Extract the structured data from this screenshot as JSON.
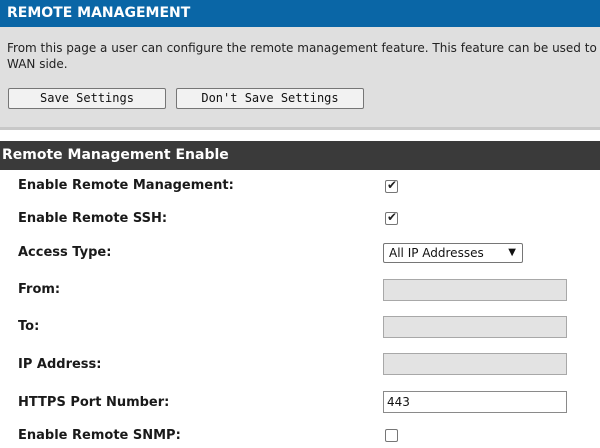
{
  "header": {
    "title": "REMOTE MANAGEMENT"
  },
  "intro": {
    "line1": "From this page a user can configure the remote management feature. This feature can be used to",
    "line2": "WAN side."
  },
  "buttons": {
    "save_label": "Save Settings",
    "dont_save_label": "Don't Save Settings"
  },
  "section": {
    "title": "Remote Management Enable"
  },
  "fields": {
    "enable_remote_management": {
      "label": "Enable Remote Management:",
      "checked": true
    },
    "enable_remote_ssh": {
      "label": "Enable Remote SSH:",
      "checked": true
    },
    "access_type": {
      "label": "Access Type:",
      "selected": "All IP Addresses"
    },
    "from": {
      "label": "From:",
      "value": ""
    },
    "to": {
      "label": "To:",
      "value": ""
    },
    "ip_address": {
      "label": "IP Address:",
      "value": ""
    },
    "https_port": {
      "label": "HTTPS Port Number:",
      "value": "443"
    },
    "enable_remote_snmp": {
      "label": "Enable Remote SNMP:",
      "checked": false
    }
  },
  "icons": {
    "checkmark": "check-icon",
    "dropdown": "chevron-down-icon"
  },
  "colors": {
    "header_bg": "#0a66a6",
    "section_bg": "#3a3a3a",
    "intro_bg": "#dfdfdf"
  }
}
